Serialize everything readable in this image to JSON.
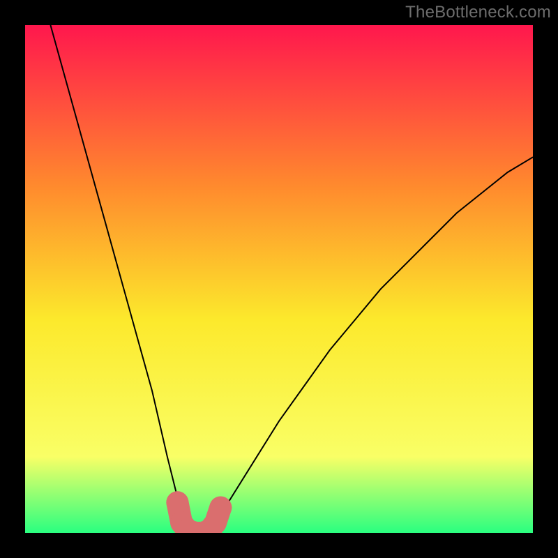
{
  "watermark": "TheBottleneck.com",
  "chart_data": {
    "type": "line",
    "title": "",
    "xlabel": "",
    "ylabel": "",
    "xlim": [
      0,
      100
    ],
    "ylim": [
      0,
      100
    ],
    "grid": false,
    "legend": false,
    "background_gradient": {
      "top_color": "#ff174d",
      "mid_top_color": "#ff8b2d",
      "mid_color": "#fce92c",
      "mid_low_color": "#f9ff66",
      "bottom_color": "#2aff80"
    },
    "series": [
      {
        "name": "bottleneck-curve",
        "color": "#000000",
        "x": [
          5,
          10,
          15,
          20,
          25,
          28,
          30,
          32,
          34,
          36,
          38,
          40,
          45,
          50,
          55,
          60,
          65,
          70,
          75,
          80,
          85,
          90,
          95,
          100
        ],
        "y": [
          100,
          82,
          64,
          46,
          28,
          15,
          7,
          2,
          0,
          0,
          2,
          6,
          14,
          22,
          29,
          36,
          42,
          48,
          53,
          58,
          63,
          67,
          71,
          74
        ]
      }
    ],
    "highlight": {
      "name": "optimal-range-marker",
      "color": "#da6e6e",
      "x": [
        30.0,
        30.8,
        32.0,
        33.5,
        35.0,
        36.3,
        37.5,
        38.5
      ],
      "y": [
        6.0,
        2.0,
        0.5,
        0.0,
        0.0,
        0.5,
        2.0,
        5.0
      ],
      "marker_radius": 2.2
    }
  }
}
